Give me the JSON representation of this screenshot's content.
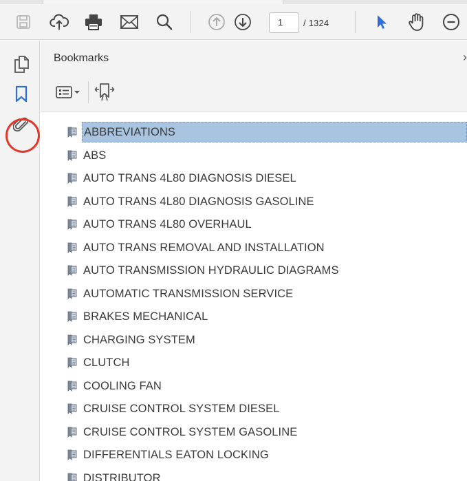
{
  "toolbar": {
    "icons": [
      "save-icon",
      "cloud-upload-icon",
      "print-icon",
      "email-icon",
      "search-icon",
      "previous-page-icon",
      "next-page-icon",
      "select-tool-icon",
      "hand-tool-icon",
      "zoom-out-icon"
    ],
    "current_page": "1",
    "total_pages": "/ 1324"
  },
  "left_rail": {
    "icons": [
      "page-thumbnails-icon",
      "bookmark-icon",
      "attachment-icon"
    ],
    "highlight_color": "#e0382b"
  },
  "bookmarks": {
    "title": "Bookmarks",
    "selected_index": 0,
    "selected_color": "#a8c4e0",
    "items": [
      {
        "label": "ABBREVIATIONS"
      },
      {
        "label": "ABS"
      },
      {
        "label": "AUTO TRANS 4L80 DIAGNOSIS DIESEL"
      },
      {
        "label": "AUTO TRANS 4L80 DIAGNOSIS GASOLINE"
      },
      {
        "label": "AUTO TRANS 4L80 OVERHAUL"
      },
      {
        "label": "AUTO TRANS REMOVAL AND INSTALLATION"
      },
      {
        "label": "AUTO TRANSMISSION HYDRAULIC DIAGRAMS"
      },
      {
        "label": "AUTOMATIC TRANSMISSION SERVICE"
      },
      {
        "label": "BRAKES MECHANICAL"
      },
      {
        "label": "CHARGING SYSTEM"
      },
      {
        "label": "CLUTCH"
      },
      {
        "label": "COOLING FAN"
      },
      {
        "label": "CRUISE CONTROL SYSTEM DIESEL"
      },
      {
        "label": "CRUISE CONTROL SYSTEM GASOLINE"
      },
      {
        "label": "DIFFERENTIALS EATON LOCKING"
      },
      {
        "label": "DISTRIBUTOR"
      }
    ]
  }
}
